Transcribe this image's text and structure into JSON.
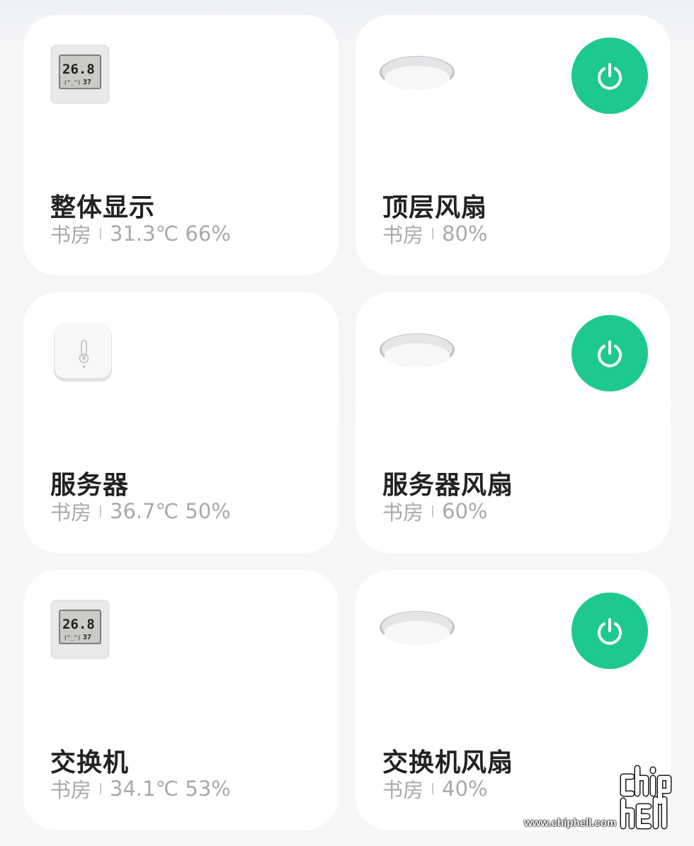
{
  "devices": [
    {
      "name": "整体显示",
      "room": "书房",
      "status": "31.3℃ 66%",
      "kind": "thermometer-lcd",
      "has_power": false
    },
    {
      "name": "顶层风扇",
      "room": "书房",
      "status": "80%",
      "kind": "ceiling-fan",
      "has_power": true
    },
    {
      "name": "服务器",
      "room": "书房",
      "status": "36.7℃ 50%",
      "kind": "temp-sensor",
      "has_power": false
    },
    {
      "name": "服务器风扇",
      "room": "书房",
      "status": "60%",
      "kind": "ceiling-fan",
      "has_power": true
    },
    {
      "name": "交换机",
      "room": "书房",
      "status": "34.1℃ 53%",
      "kind": "thermometer-lcd",
      "has_power": false
    },
    {
      "name": "交换机风扇",
      "room": "书房",
      "status": "40%",
      "kind": "ceiling-fan",
      "has_power": true
    }
  ],
  "lcd": {
    "temp": "26.8",
    "face": "(^_^)",
    "hum": "37"
  },
  "colors": {
    "power_on": "#1dc98e",
    "card_bg": "#ffffff",
    "title": "#222222",
    "subtitle": "#a9a9ab"
  },
  "watermark": {
    "url": "www.chiphell.com",
    "logo": "chiphell"
  }
}
